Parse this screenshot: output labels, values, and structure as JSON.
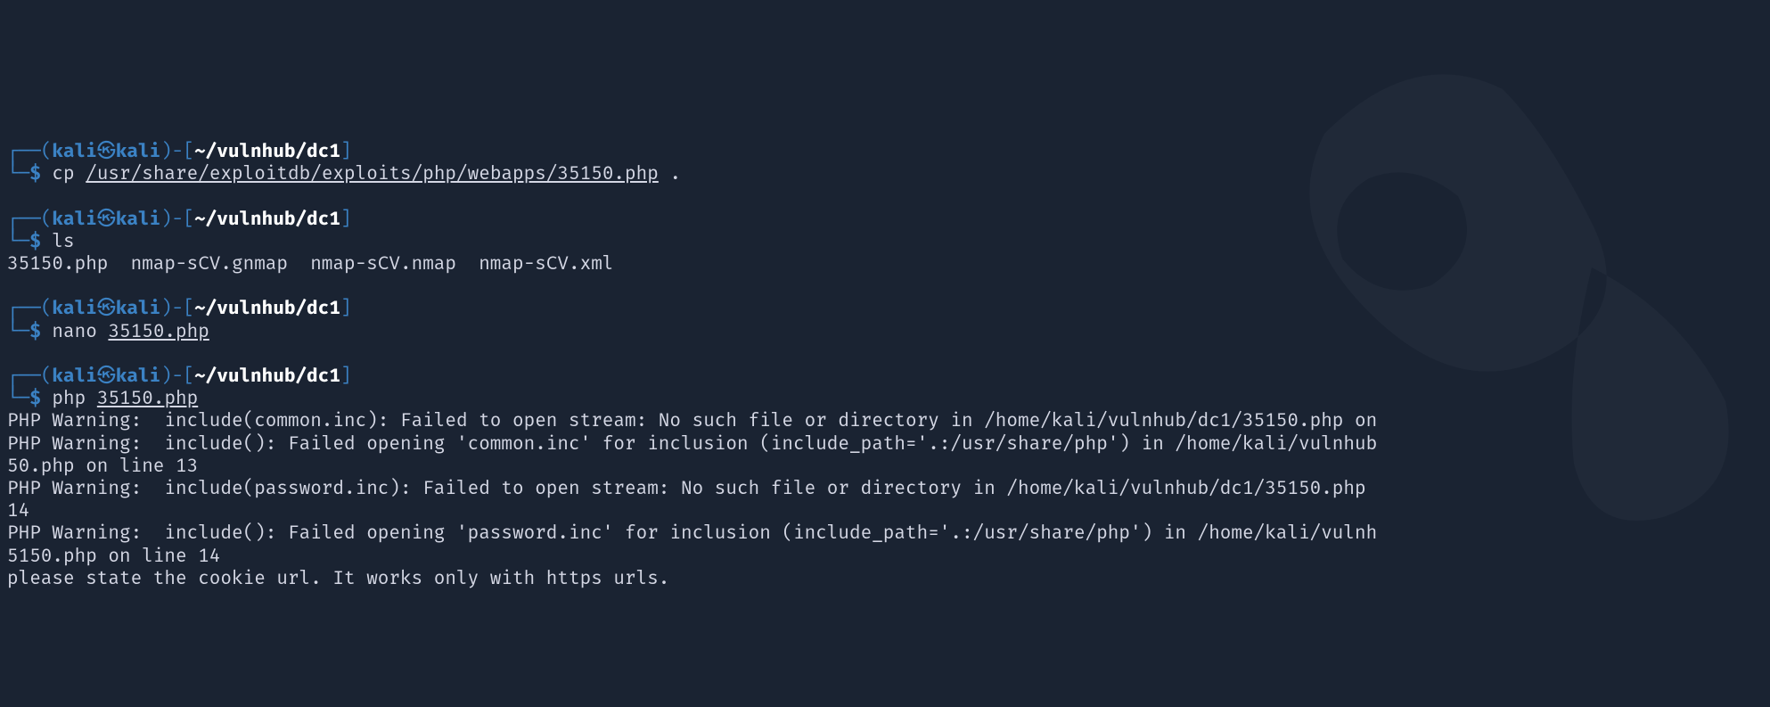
{
  "prompt": {
    "top_corner": "┌──",
    "bottom_corner": "└─",
    "open_paren": "(",
    "close_paren": ")",
    "user": "kali",
    "skull": "㉿",
    "host": "kali",
    "dash": "-",
    "open_bracket": "[",
    "close_bracket": "]",
    "path": "~/vulnhub/dc1",
    "dollar": "$"
  },
  "blocks": [
    {
      "cmd": "cp",
      "arg_underlined": "/usr/share/exploitdb/exploits/php/webapps/35150.php",
      "arg_trailing": " .",
      "output": []
    },
    {
      "cmd": "ls",
      "arg_underlined": "",
      "arg_trailing": "",
      "output": [
        "35150.php  nmap-sCV.gnmap  nmap-sCV.nmap  nmap-sCV.xml"
      ]
    },
    {
      "cmd": "nano",
      "arg_underlined": "35150.php",
      "arg_trailing": "",
      "output": []
    },
    {
      "cmd": "php",
      "arg_underlined": "35150.php",
      "arg_trailing": "",
      "output": [
        "PHP Warning:  include(common.inc): Failed to open stream: No such file or directory in /home/kali/vulnhub/dc1/35150.php on",
        "PHP Warning:  include(): Failed opening 'common.inc' for inclusion (include_path='.:/usr/share/php') in /home/kali/vulnhub",
        "50.php on line 13",
        "PHP Warning:  include(password.inc): Failed to open stream: No such file or directory in /home/kali/vulnhub/dc1/35150.php",
        "14",
        "PHP Warning:  include(): Failed opening 'password.inc' for inclusion (include_path='.:/usr/share/php') in /home/kali/vulnh",
        "5150.php on line 14",
        "please state the cookie url. It works only with https urls."
      ]
    }
  ]
}
